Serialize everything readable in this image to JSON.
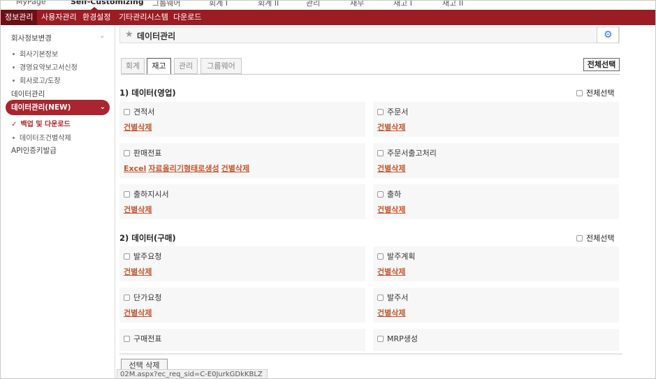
{
  "topnav": [
    "MyPage",
    "Self-Customizing",
    "그룹웨어",
    "회계 I",
    "회계 II",
    "관리",
    "재무",
    "재고 I",
    "재고 II"
  ],
  "subnav": [
    "정보관리",
    "사용자관리",
    "환경설정",
    "기타관리시스템",
    "다운로드"
  ],
  "sidebar": {
    "group1": "회사정보변경",
    "group1_items": [
      "회사기본정보",
      "경영요약보고서신청",
      "회사로고/도장"
    ],
    "data_manage": "데이터관리",
    "active": "데이터관리(NEW)",
    "active_items": [
      "백업 및 다운로드",
      "데이터조건별삭제"
    ],
    "api": "API인증키발급"
  },
  "header": {
    "title": "데이터관리"
  },
  "tabs": [
    "회계",
    "재고",
    "관리",
    "그룹웨어"
  ],
  "select_all_button": "전체선택",
  "sections": [
    {
      "title": "1) 데이터(영업)",
      "select_all": "전체선택",
      "items": [
        {
          "label": "견적서",
          "actions": [
            "건별삭제"
          ]
        },
        {
          "label": "주문서",
          "actions": [
            "건별삭제"
          ]
        },
        {
          "label": "판매전표",
          "actions": [
            "Excel",
            "자료올리기형태로생성",
            "건별삭제"
          ]
        },
        {
          "label": "주문서출고처리",
          "actions": [
            "건별삭제"
          ]
        },
        {
          "label": "출하지시서",
          "actions": [
            "건별삭제"
          ]
        },
        {
          "label": "출하",
          "actions": [
            "건별삭제"
          ]
        }
      ]
    },
    {
      "title": "2) 데이터(구매)",
      "select_all": "전체선택",
      "items": [
        {
          "label": "발주요청",
          "actions": [
            "건별삭제"
          ]
        },
        {
          "label": "발주계획",
          "actions": [
            "건별삭제"
          ]
        },
        {
          "label": "단가요청",
          "actions": [
            "건별삭제"
          ]
        },
        {
          "label": "발주서",
          "actions": [
            "건별삭제"
          ]
        },
        {
          "label": "구매전표",
          "actions": []
        },
        {
          "label": "MRP생성",
          "actions": []
        }
      ]
    }
  ],
  "delete_button": "선택 삭제",
  "status_url": "02M.aspx?ec_req_sid=C-E0JurkGDkKBLZ"
}
